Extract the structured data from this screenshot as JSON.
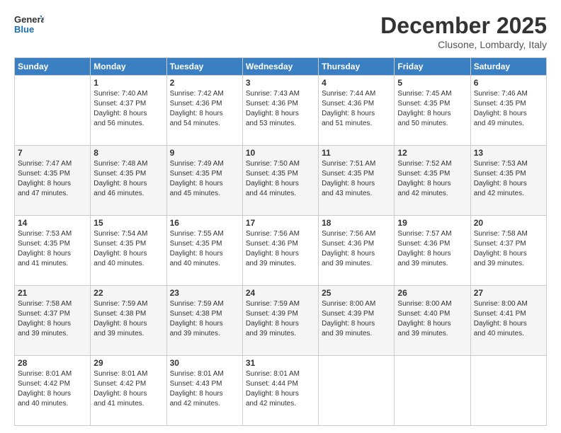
{
  "header": {
    "logo_line1": "General",
    "logo_line2": "Blue",
    "month": "December 2025",
    "location": "Clusone, Lombardy, Italy"
  },
  "weekdays": [
    "Sunday",
    "Monday",
    "Tuesday",
    "Wednesday",
    "Thursday",
    "Friday",
    "Saturday"
  ],
  "weeks": [
    [
      {
        "day": "",
        "info": ""
      },
      {
        "day": "1",
        "info": "Sunrise: 7:40 AM\nSunset: 4:37 PM\nDaylight: 8 hours\nand 56 minutes."
      },
      {
        "day": "2",
        "info": "Sunrise: 7:42 AM\nSunset: 4:36 PM\nDaylight: 8 hours\nand 54 minutes."
      },
      {
        "day": "3",
        "info": "Sunrise: 7:43 AM\nSunset: 4:36 PM\nDaylight: 8 hours\nand 53 minutes."
      },
      {
        "day": "4",
        "info": "Sunrise: 7:44 AM\nSunset: 4:36 PM\nDaylight: 8 hours\nand 51 minutes."
      },
      {
        "day": "5",
        "info": "Sunrise: 7:45 AM\nSunset: 4:35 PM\nDaylight: 8 hours\nand 50 minutes."
      },
      {
        "day": "6",
        "info": "Sunrise: 7:46 AM\nSunset: 4:35 PM\nDaylight: 8 hours\nand 49 minutes."
      }
    ],
    [
      {
        "day": "7",
        "info": "Sunrise: 7:47 AM\nSunset: 4:35 PM\nDaylight: 8 hours\nand 47 minutes."
      },
      {
        "day": "8",
        "info": "Sunrise: 7:48 AM\nSunset: 4:35 PM\nDaylight: 8 hours\nand 46 minutes."
      },
      {
        "day": "9",
        "info": "Sunrise: 7:49 AM\nSunset: 4:35 PM\nDaylight: 8 hours\nand 45 minutes."
      },
      {
        "day": "10",
        "info": "Sunrise: 7:50 AM\nSunset: 4:35 PM\nDaylight: 8 hours\nand 44 minutes."
      },
      {
        "day": "11",
        "info": "Sunrise: 7:51 AM\nSunset: 4:35 PM\nDaylight: 8 hours\nand 43 minutes."
      },
      {
        "day": "12",
        "info": "Sunrise: 7:52 AM\nSunset: 4:35 PM\nDaylight: 8 hours\nand 42 minutes."
      },
      {
        "day": "13",
        "info": "Sunrise: 7:53 AM\nSunset: 4:35 PM\nDaylight: 8 hours\nand 42 minutes."
      }
    ],
    [
      {
        "day": "14",
        "info": "Sunrise: 7:53 AM\nSunset: 4:35 PM\nDaylight: 8 hours\nand 41 minutes."
      },
      {
        "day": "15",
        "info": "Sunrise: 7:54 AM\nSunset: 4:35 PM\nDaylight: 8 hours\nand 40 minutes."
      },
      {
        "day": "16",
        "info": "Sunrise: 7:55 AM\nSunset: 4:35 PM\nDaylight: 8 hours\nand 40 minutes."
      },
      {
        "day": "17",
        "info": "Sunrise: 7:56 AM\nSunset: 4:36 PM\nDaylight: 8 hours\nand 39 minutes."
      },
      {
        "day": "18",
        "info": "Sunrise: 7:56 AM\nSunset: 4:36 PM\nDaylight: 8 hours\nand 39 minutes."
      },
      {
        "day": "19",
        "info": "Sunrise: 7:57 AM\nSunset: 4:36 PM\nDaylight: 8 hours\nand 39 minutes."
      },
      {
        "day": "20",
        "info": "Sunrise: 7:58 AM\nSunset: 4:37 PM\nDaylight: 8 hours\nand 39 minutes."
      }
    ],
    [
      {
        "day": "21",
        "info": "Sunrise: 7:58 AM\nSunset: 4:37 PM\nDaylight: 8 hours\nand 39 minutes."
      },
      {
        "day": "22",
        "info": "Sunrise: 7:59 AM\nSunset: 4:38 PM\nDaylight: 8 hours\nand 39 minutes."
      },
      {
        "day": "23",
        "info": "Sunrise: 7:59 AM\nSunset: 4:38 PM\nDaylight: 8 hours\nand 39 minutes."
      },
      {
        "day": "24",
        "info": "Sunrise: 7:59 AM\nSunset: 4:39 PM\nDaylight: 8 hours\nand 39 minutes."
      },
      {
        "day": "25",
        "info": "Sunrise: 8:00 AM\nSunset: 4:39 PM\nDaylight: 8 hours\nand 39 minutes."
      },
      {
        "day": "26",
        "info": "Sunrise: 8:00 AM\nSunset: 4:40 PM\nDaylight: 8 hours\nand 39 minutes."
      },
      {
        "day": "27",
        "info": "Sunrise: 8:00 AM\nSunset: 4:41 PM\nDaylight: 8 hours\nand 40 minutes."
      }
    ],
    [
      {
        "day": "28",
        "info": "Sunrise: 8:01 AM\nSunset: 4:42 PM\nDaylight: 8 hours\nand 40 minutes."
      },
      {
        "day": "29",
        "info": "Sunrise: 8:01 AM\nSunset: 4:42 PM\nDaylight: 8 hours\nand 41 minutes."
      },
      {
        "day": "30",
        "info": "Sunrise: 8:01 AM\nSunset: 4:43 PM\nDaylight: 8 hours\nand 42 minutes."
      },
      {
        "day": "31",
        "info": "Sunrise: 8:01 AM\nSunset: 4:44 PM\nDaylight: 8 hours\nand 42 minutes."
      },
      {
        "day": "",
        "info": ""
      },
      {
        "day": "",
        "info": ""
      },
      {
        "day": "",
        "info": ""
      }
    ]
  ]
}
